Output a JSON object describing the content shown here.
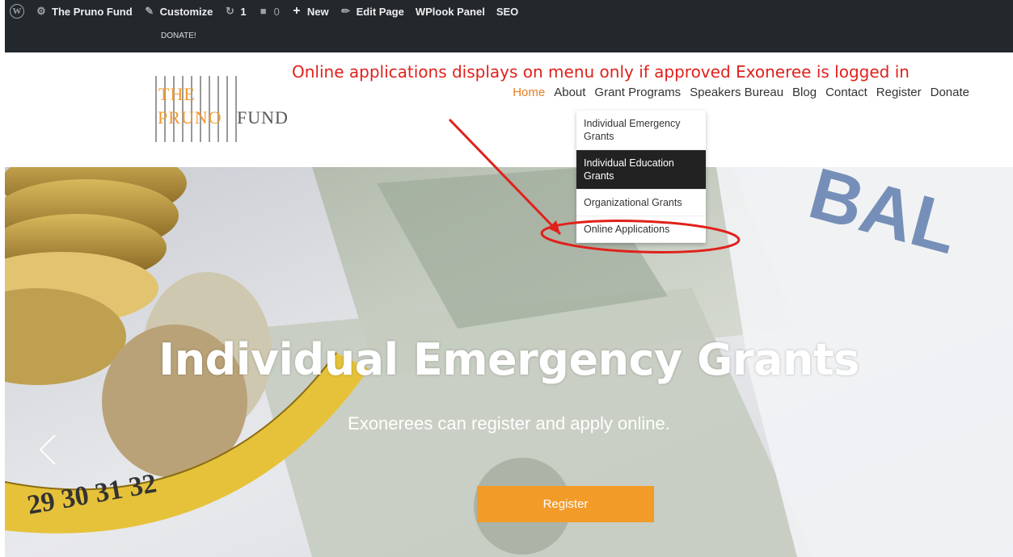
{
  "admin_bar": {
    "site_name": "The Pruno Fund",
    "customize": "Customize",
    "updates_count": "1",
    "comments_count": "0",
    "new_label": "New",
    "edit_page": "Edit Page",
    "wplook_panel": "WPlook Panel",
    "seo": "SEO",
    "donate": "DONATE!"
  },
  "logo": {
    "line1": "THE",
    "line2a": "PRUNO",
    "line2b": "FUND"
  },
  "annotation": "Online applications displays on menu only if approved Exoneree is logged in",
  "nav": {
    "items": [
      "Home",
      "About",
      "Grant Programs",
      "Speakers Bureau",
      "Blog",
      "Contact",
      "Register",
      "Donate"
    ],
    "active": "Home"
  },
  "submenu": {
    "items": [
      "Individual Emergency Grants",
      "Individual Education Grants",
      "Organizational Grants",
      "Online Applications"
    ],
    "active": "Individual Education Grants"
  },
  "hero": {
    "title": "Individual Emergency Grants",
    "subtitle": "Exonerees can register and apply online.",
    "button": "Register"
  },
  "colors": {
    "accent": "#f39b28",
    "admin_bar": "#23282d",
    "annotation": "#e0211b"
  }
}
